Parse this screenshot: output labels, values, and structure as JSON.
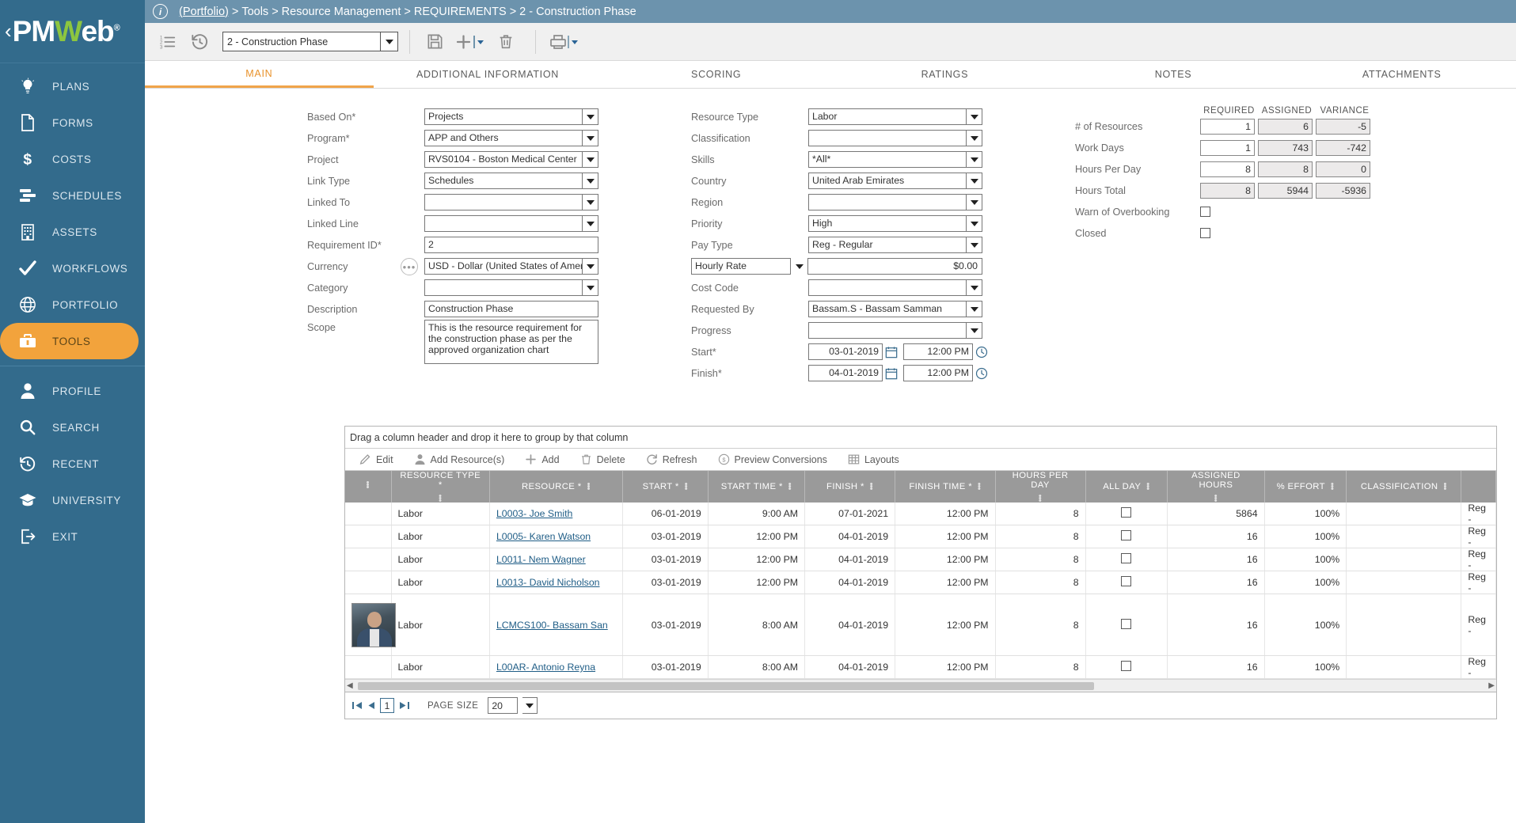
{
  "brand": {
    "name_pm": "PM",
    "name_w": "W",
    "name_eb": "eb",
    "reg": "®",
    "collapse": "‹"
  },
  "sidebar": {
    "items": [
      {
        "label": "PLANS",
        "icon": "lightbulb-icon",
        "active": false
      },
      {
        "label": "FORMS",
        "icon": "document-icon",
        "active": false
      },
      {
        "label": "COSTS",
        "icon": "dollar-icon",
        "active": false
      },
      {
        "label": "SCHEDULES",
        "icon": "gantt-icon",
        "active": false
      },
      {
        "label": "ASSETS",
        "icon": "building-icon",
        "active": false
      },
      {
        "label": "WORKFLOWS",
        "icon": "check-icon",
        "active": false
      },
      {
        "label": "PORTFOLIO",
        "icon": "globe-icon",
        "active": false
      },
      {
        "label": "TOOLS",
        "icon": "toolbox-icon",
        "active": true
      }
    ],
    "items2": [
      {
        "label": "PROFILE",
        "icon": "person-icon"
      },
      {
        "label": "SEARCH",
        "icon": "magnifier-icon"
      },
      {
        "label": "RECENT",
        "icon": "history-icon"
      },
      {
        "label": "UNIVERSITY",
        "icon": "graduation-icon"
      },
      {
        "label": "EXIT",
        "icon": "exit-icon"
      }
    ]
  },
  "breadcrumb": {
    "root": "(Portfolio)",
    "sep": ">",
    "parts": [
      "Tools",
      "Resource Management",
      "REQUIREMENTS",
      "2 - Construction Phase"
    ]
  },
  "toolbar": {
    "list_icon": "numbered-list-icon",
    "history_icon": "history-icon",
    "record_select": "2  -  Construction Phase",
    "save_icon": "save-icon",
    "add_icon": "plus-icon",
    "delete_icon": "trash-icon",
    "print_icon": "printer-icon"
  },
  "tabs": [
    {
      "label": "MAIN",
      "active": true
    },
    {
      "label": "ADDITIONAL INFORMATION",
      "active": false
    },
    {
      "label": "SCORING",
      "active": false
    },
    {
      "label": "RATINGS",
      "active": false
    },
    {
      "label": "NOTES",
      "active": false
    },
    {
      "label": "ATTACHMENTS",
      "active": false
    }
  ],
  "form": {
    "left": [
      {
        "label": "Based On*",
        "value": "Projects",
        "type": "dropdown"
      },
      {
        "label": "Program*",
        "value": "APP and Others",
        "type": "dropdown"
      },
      {
        "label": "Project",
        "value": "RVS0104 - Boston Medical Center",
        "type": "dropdown"
      },
      {
        "label": "Link Type",
        "value": "Schedules",
        "type": "dropdown"
      },
      {
        "label": "Linked To",
        "value": "",
        "type": "dropdown"
      },
      {
        "label": "Linked Line",
        "value": "",
        "type": "dropdown"
      },
      {
        "label": "Requirement ID*",
        "value": "2",
        "type": "text"
      },
      {
        "label": "Currency",
        "value": "USD - Dollar (United States of Ameri",
        "type": "dropdown-dots"
      },
      {
        "label": "Category",
        "value": "",
        "type": "dropdown"
      },
      {
        "label": "Description",
        "value": "Construction Phase",
        "type": "text"
      },
      {
        "label": "Scope",
        "value": "This is the resource requirement for the construction phase as per the approved organization chart",
        "type": "textarea"
      }
    ],
    "middle": [
      {
        "label": "Resource Type",
        "value": "Labor",
        "type": "dropdown"
      },
      {
        "label": "Classification",
        "value": "",
        "type": "dropdown"
      },
      {
        "label": "Skills",
        "value": "*All*",
        "type": "dropdown"
      },
      {
        "label": "Country",
        "value": "United Arab Emirates",
        "type": "dropdown"
      },
      {
        "label": "Region",
        "value": "",
        "type": "dropdown"
      },
      {
        "label": "Priority",
        "value": "High",
        "type": "dropdown"
      },
      {
        "label": "Pay Type",
        "value": "Reg - Regular",
        "type": "dropdown"
      }
    ],
    "rate": {
      "mode": "Hourly Rate",
      "value": "$0.00"
    },
    "middle2": [
      {
        "label": "Cost Code",
        "value": "",
        "type": "dropdown"
      },
      {
        "label": "Requested By",
        "value": "Bassam.S - Bassam Samman",
        "type": "dropdown"
      },
      {
        "label": "Progress",
        "value": "",
        "type": "dropdown"
      }
    ],
    "dates": [
      {
        "label": "Start*",
        "date": "03-01-2019",
        "time": "12:00 PM"
      },
      {
        "label": "Finish*",
        "date": "04-01-2019",
        "time": "12:00 PM"
      }
    ]
  },
  "summary": {
    "headers": [
      "REQUIRED",
      "ASSIGNED",
      "VARIANCE"
    ],
    "rows": [
      {
        "label": "# of Resources",
        "required": "1",
        "assigned": "6",
        "variance": "-5"
      },
      {
        "label": "Work Days",
        "required": "1",
        "assigned": "743",
        "variance": "-742"
      },
      {
        "label": "Hours Per Day",
        "required": "8",
        "assigned": "8",
        "variance": "0"
      },
      {
        "label": "Hours Total",
        "required": "8",
        "assigned": "5944",
        "variance": "-5936"
      }
    ],
    "checks": [
      {
        "label": "Warn of Overbooking",
        "checked": false
      },
      {
        "label": "Closed",
        "checked": false
      }
    ]
  },
  "grid": {
    "group_hint": "Drag a column header and drop it here to group by that column",
    "toolbar": [
      {
        "label": "Edit",
        "icon": "pencil-icon"
      },
      {
        "label": "Add Resource(s)",
        "icon": "person-icon"
      },
      {
        "label": "Add",
        "icon": "plus-icon"
      },
      {
        "label": "Delete",
        "icon": "trash-icon"
      },
      {
        "label": "Refresh",
        "icon": "refresh-icon"
      },
      {
        "label": "Preview Conversions",
        "icon": "dollar-circle-icon"
      },
      {
        "label": "Layouts",
        "icon": "grid-icon"
      }
    ],
    "columns": [
      "",
      "RESOURCE TYPE *",
      "RESOURCE *",
      "START *",
      "START TIME *",
      "FINISH *",
      "FINISH TIME *",
      "HOURS PER DAY",
      "ALL DAY",
      "ASSIGNED HOURS",
      "% EFFORT",
      "CLASSIFICATION",
      ""
    ],
    "rows": [
      {
        "avatar": false,
        "type": "Labor",
        "resource": "L0003- Joe Smith",
        "link": true,
        "start": "06-01-2019",
        "start_time": "9:00 AM",
        "finish": "07-01-2021",
        "finish_time": "12:00 PM",
        "hours_per_day": "8",
        "all_day": false,
        "assigned_hours": "5864",
        "effort": "100%",
        "classification": "",
        "last": "Reg -"
      },
      {
        "avatar": false,
        "type": "Labor",
        "resource": "L0005- Karen Watson",
        "link": true,
        "start": "03-01-2019",
        "start_time": "12:00 PM",
        "finish": "04-01-2019",
        "finish_time": "12:00 PM",
        "hours_per_day": "8",
        "all_day": false,
        "assigned_hours": "16",
        "effort": "100%",
        "classification": "",
        "last": "Reg -"
      },
      {
        "avatar": false,
        "type": "Labor",
        "resource": "L0011- Nem Wagner",
        "link": true,
        "start": "03-01-2019",
        "start_time": "12:00 PM",
        "finish": "04-01-2019",
        "finish_time": "12:00 PM",
        "hours_per_day": "8",
        "all_day": false,
        "assigned_hours": "16",
        "effort": "100%",
        "classification": "",
        "last": "Reg -"
      },
      {
        "avatar": false,
        "type": "Labor",
        "resource": "L0013- David Nicholson",
        "link": true,
        "start": "03-01-2019",
        "start_time": "12:00 PM",
        "finish": "04-01-2019",
        "finish_time": "12:00 PM",
        "hours_per_day": "8",
        "all_day": false,
        "assigned_hours": "16",
        "effort": "100%",
        "classification": "",
        "last": "Reg -"
      },
      {
        "avatar": true,
        "type": "Labor",
        "resource": "LCMCS100- Bassam San",
        "link": true,
        "start": "03-01-2019",
        "start_time": "8:00 AM",
        "finish": "04-01-2019",
        "finish_time": "12:00 PM",
        "hours_per_day": "8",
        "all_day": false,
        "assigned_hours": "16",
        "effort": "100%",
        "classification": "",
        "last": "Reg -"
      },
      {
        "avatar": false,
        "type": "Labor",
        "resource": "L00AR- Antonio Reyna",
        "link": true,
        "start": "03-01-2019",
        "start_time": "8:00 AM",
        "finish": "04-01-2019",
        "finish_time": "12:00 PM",
        "hours_per_day": "8",
        "all_day": false,
        "assigned_hours": "16",
        "effort": "100%",
        "classification": "",
        "last": "Reg -"
      }
    ],
    "pager": {
      "first": "⏮",
      "prev": "◀",
      "page": "1",
      "next": "⏭",
      "page_size_label": "PAGE SIZE",
      "page_size": "20"
    }
  },
  "colors": {
    "sidebar": "#336b8c",
    "accent": "#f2a33c",
    "breadcrumb": "#6c93ad",
    "grid_header": "#9a9a9a",
    "link": "#1f5d86"
  }
}
